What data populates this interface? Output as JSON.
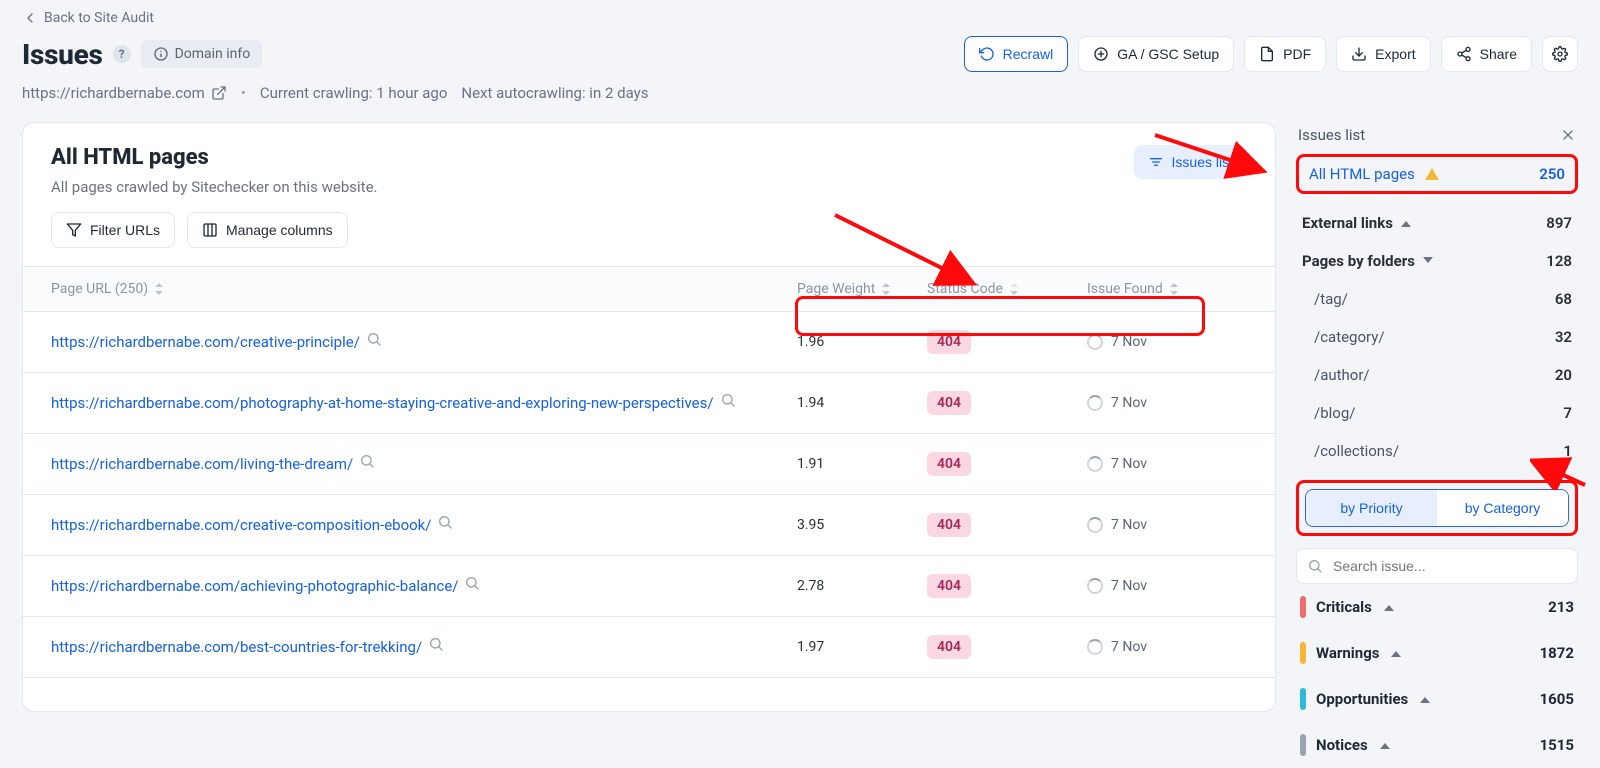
{
  "nav": {
    "back": "Back to Site Audit"
  },
  "header": {
    "title": "Issues",
    "domain_info": "Domain info",
    "url": "https://richardbernabe.com",
    "crawl_status": "Current crawling: 1 hour ago",
    "next": "Next autocrawling: in 2 days"
  },
  "actions": {
    "recrawl": "Recrawl",
    "ga_gsc": "GA / GSC Setup",
    "pdf": "PDF",
    "export": "Export",
    "share": "Share"
  },
  "main": {
    "title": "All HTML pages",
    "subtitle": "All pages crawled by Sitechecker on this website.",
    "issues_list": "Issues list",
    "filter": "Filter URLs",
    "manage_cols": "Manage columns",
    "columns": {
      "page_url": "Page URL (250)",
      "page_weight": "Page Weight",
      "status_code": "Status Code",
      "issue_found": "Issue Found"
    },
    "rows": [
      {
        "url": "https://richardbernabe.com/creative-principle/",
        "weight": "1.96",
        "code": "404",
        "found": "7 Nov"
      },
      {
        "url": "https://richardbernabe.com/photography-at-home-staying-creative-and-exploring-new-perspectives/",
        "weight": "1.94",
        "code": "404",
        "found": "7 Nov"
      },
      {
        "url": "https://richardbernabe.com/living-the-dream/",
        "weight": "1.91",
        "code": "404",
        "found": "7 Nov"
      },
      {
        "url": "https://richardbernabe.com/creative-composition-ebook/",
        "weight": "3.95",
        "code": "404",
        "found": "7 Nov"
      },
      {
        "url": "https://richardbernabe.com/achieving-photographic-balance/",
        "weight": "2.78",
        "code": "404",
        "found": "7 Nov"
      },
      {
        "url": "https://richardbernabe.com/best-countries-for-trekking/",
        "weight": "1.97",
        "code": "404",
        "found": "7 Nov"
      }
    ]
  },
  "side": {
    "title": "Issues list",
    "all_html": {
      "label": "All HTML pages",
      "count": "250"
    },
    "external": {
      "label": "External links",
      "count": "897"
    },
    "folders": {
      "label": "Pages by folders",
      "count": "128"
    },
    "folder_rows": [
      {
        "path": "/tag/",
        "count": "68"
      },
      {
        "path": "/category/",
        "count": "32"
      },
      {
        "path": "/author/",
        "count": "20"
      },
      {
        "path": "/blog/",
        "count": "7"
      },
      {
        "path": "/collections/",
        "count": "1"
      }
    ],
    "seg": {
      "priority": "by Priority",
      "category": "by Category"
    },
    "search_ph": "Search issue...",
    "severity": [
      {
        "label": "Criticals",
        "count": "213",
        "color": "#f26d6d"
      },
      {
        "label": "Warnings",
        "count": "1872",
        "color": "#f6b63a"
      },
      {
        "label": "Opportunities",
        "count": "1605",
        "color": "#2fb9d9"
      },
      {
        "label": "Notices",
        "count": "1515",
        "color": "#9aa3af"
      }
    ]
  }
}
